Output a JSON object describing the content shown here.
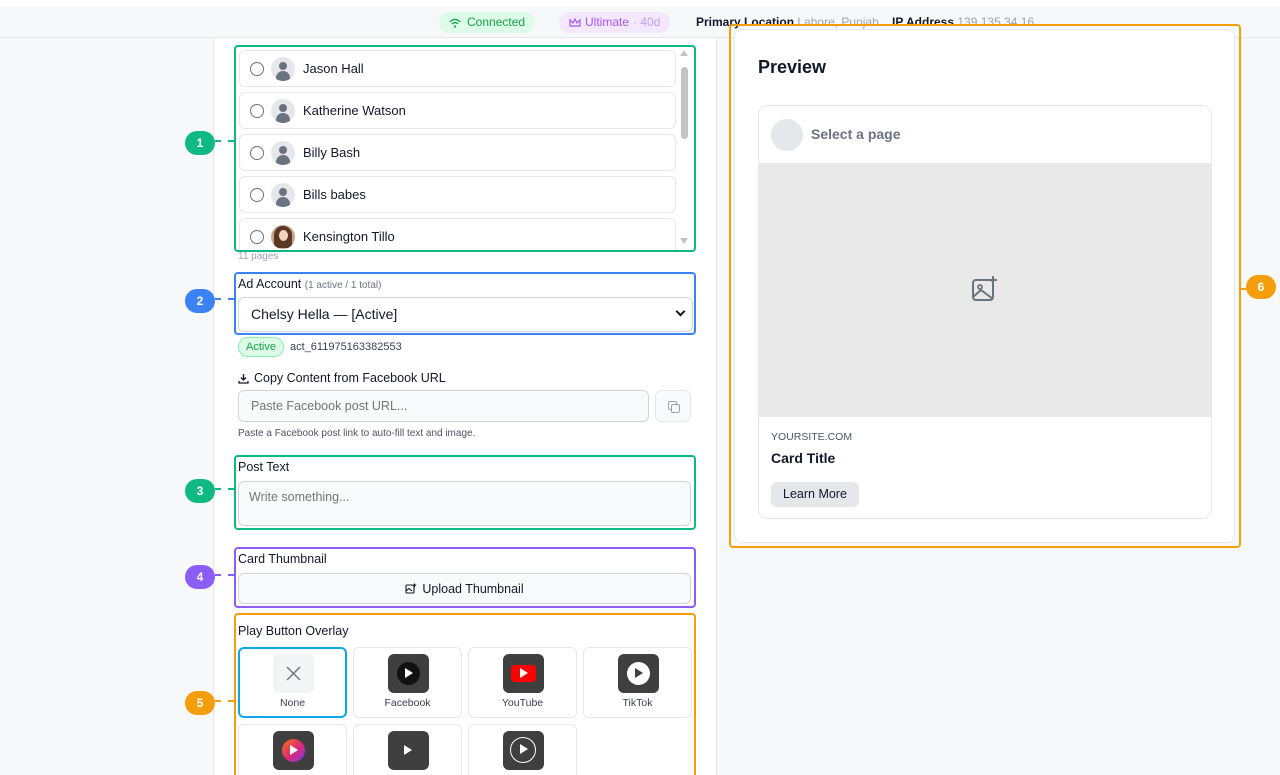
{
  "topbar": {
    "connected": "Connected",
    "plan": "Ultimate",
    "plan_days": "· 40d",
    "location_label": "Primary Location",
    "location_value": "Lahore, Punjab",
    "ip_label": "IP Address",
    "ip_value": "139.135.34.16"
  },
  "pages": {
    "items": [
      {
        "name": "Jason Hall"
      },
      {
        "name": "Katherine Watson"
      },
      {
        "name": "Billy Bash"
      },
      {
        "name": "Bills babes"
      },
      {
        "name": "Kensington Tillo"
      }
    ],
    "count": "11 pages"
  },
  "ad_account": {
    "label": "Ad Account",
    "summary": "(1 active / 1 total)",
    "selected": "Chelsy Hella — [Active]",
    "status": "Active",
    "account_id": "act_611975163382553"
  },
  "copy_content": {
    "label": "Copy Content from Facebook URL",
    "placeholder": "Paste Facebook post URL...",
    "hint": "Paste a Facebook post link to auto-fill text and image."
  },
  "post_text": {
    "label": "Post Text",
    "placeholder": "Write something..."
  },
  "thumbnail": {
    "label": "Card Thumbnail",
    "button": "Upload Thumbnail"
  },
  "overlay": {
    "label": "Play Button Overlay",
    "options": [
      {
        "label": "None"
      },
      {
        "label": "Facebook"
      },
      {
        "label": "YouTube"
      },
      {
        "label": "TikTok"
      }
    ],
    "selected": "None"
  },
  "annotations": [
    "1",
    "2",
    "3",
    "4",
    "5",
    "6"
  ],
  "preview": {
    "title": "Preview",
    "page_placeholder": "Select a page",
    "site": "YOURSITE.COM",
    "card_title": "Card Title",
    "cta": "Learn More"
  },
  "colors": {
    "green": "#10b981",
    "blue": "#3b82f6",
    "purple": "#8b5cf6",
    "orange": "#f59e0b",
    "selected_tile": "#0ea5e9",
    "youtube_red": "#ff0000"
  }
}
